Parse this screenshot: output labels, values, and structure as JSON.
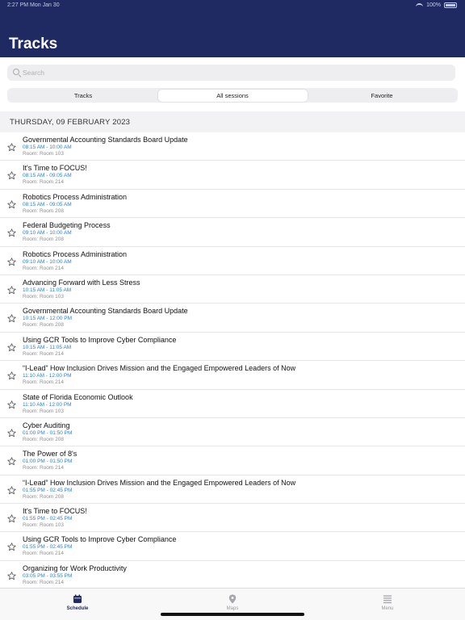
{
  "status_bar": {
    "time": "2:27 PM  Mon Jan 30",
    "battery": "100%"
  },
  "header": {
    "title": "Tracks"
  },
  "search": {
    "placeholder": "Search"
  },
  "segments": [
    {
      "label": "Tracks",
      "active": false
    },
    {
      "label": "All sessions",
      "active": true
    },
    {
      "label": "Favorite",
      "active": false
    }
  ],
  "section": {
    "title": "THURSDAY, 09 FEBRUARY 2023"
  },
  "sessions": [
    {
      "title": "Governmental Accounting Standards Board Update",
      "time": "08:15 AM - 10:00 AM",
      "room": "Room: Room 103"
    },
    {
      "title": "It's Time to FOCUS!",
      "time": "08:15 AM - 09:05 AM",
      "room": "Room: Room 214"
    },
    {
      "title": "Robotics Process Administration",
      "time": "08:15 AM - 09:05 AM",
      "room": "Room: Room 208"
    },
    {
      "title": "Federal Budgeting Process",
      "time": "09:10 AM - 10:00 AM",
      "room": "Room: Room 208"
    },
    {
      "title": "Robotics Process Administration",
      "time": "09:10 AM - 10:00 AM",
      "room": "Room: Room 214"
    },
    {
      "title": "Advancing Forward with Less Stress",
      "time": "10:15 AM - 11:05 AM",
      "room": "Room: Room 103"
    },
    {
      "title": "Governmental Accounting Standards Board Update",
      "time": "10:15 AM - 12:00 PM",
      "room": "Room: Room 208"
    },
    {
      "title": "Using GCR Tools to Improve Cyber Compliance",
      "time": "10:15 AM - 11:05 AM",
      "room": "Room: Room 214"
    },
    {
      "title": "“I-Lead” How Inclusion Drives Mission and the Engaged Empowered Leaders of Now",
      "time": "11:10 AM - 12:00 PM",
      "room": "Room: Room 214"
    },
    {
      "title": "State of Florida Economic Outlook",
      "time": "11:10 AM - 12:00 PM",
      "room": "Room: Room 103"
    },
    {
      "title": "Cyber Auditing",
      "time": "01:00 PM - 01:50 PM",
      "room": "Room: Room 208"
    },
    {
      "title": "The Power of 8's",
      "time": "01:00 PM - 01:50 PM",
      "room": "Room: Room 214"
    },
    {
      "title": "“I-Lead” How Inclusion Drives Mission and the Engaged Empowered Leaders of Now",
      "time": "01:55 PM - 02:45 PM",
      "room": "Room: Room 208"
    },
    {
      "title": "It's Time to FOCUS!",
      "time": "01:55 PM - 02:45 PM",
      "room": "Room: Room 103"
    },
    {
      "title": "Using GCR Tools to Improve Cyber Compliance",
      "time": "01:55 PM - 02:45 PM",
      "room": "Room: Room 214"
    },
    {
      "title": "Organizing for Work Productivity",
      "time": "03:05 PM - 03:55 PM",
      "room": "Room: Room 214"
    }
  ],
  "tab_bar": [
    {
      "label": "Schedule",
      "icon": "calendar-icon",
      "active": true
    },
    {
      "label": "Maps",
      "icon": "map-pin-icon",
      "active": false
    },
    {
      "label": "Menu",
      "icon": "menu-icon",
      "active": false
    }
  ],
  "colors": {
    "header_bg": "#1f2a63",
    "time_text": "#2f7fd8",
    "room_text": "#8e8e93"
  }
}
